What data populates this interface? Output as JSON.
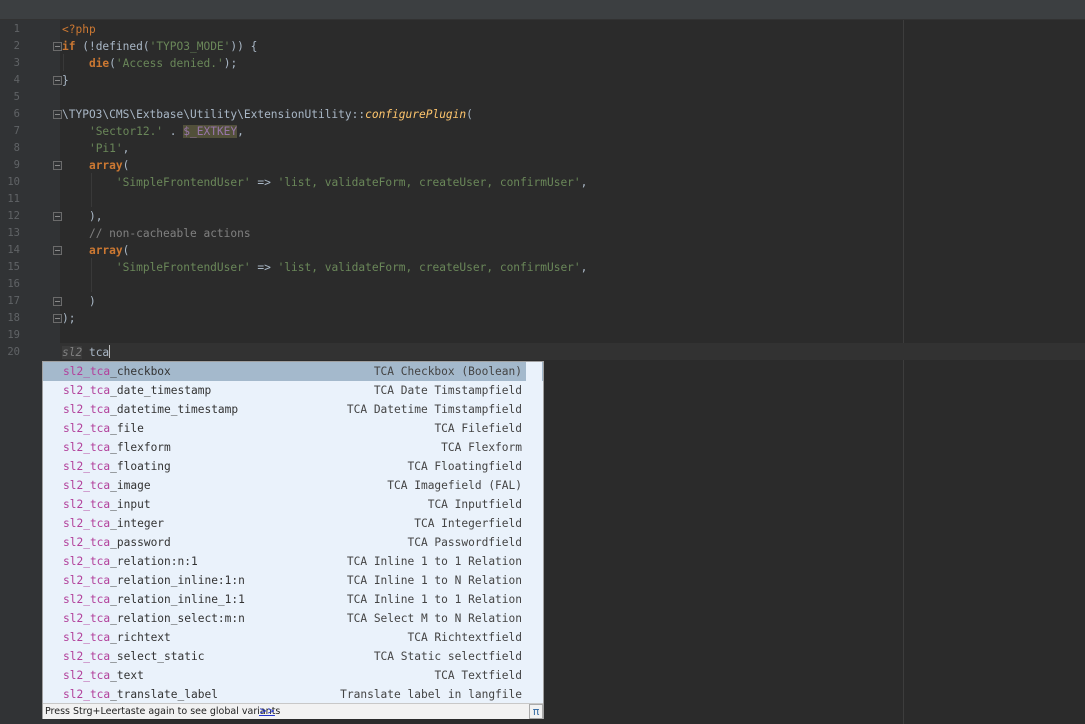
{
  "editor": {
    "lines": [
      {
        "n": "1"
      },
      {
        "n": "2"
      },
      {
        "n": "3"
      },
      {
        "n": "4"
      },
      {
        "n": "5"
      },
      {
        "n": "6"
      },
      {
        "n": "7"
      },
      {
        "n": "8"
      },
      {
        "n": "9"
      },
      {
        "n": "10"
      },
      {
        "n": "11"
      },
      {
        "n": "12"
      },
      {
        "n": "13"
      },
      {
        "n": "14"
      },
      {
        "n": "15"
      },
      {
        "n": "16"
      },
      {
        "n": "17"
      },
      {
        "n": "18"
      },
      {
        "n": "19"
      },
      {
        "n": "20"
      }
    ],
    "code": {
      "l1": "<?php",
      "l2_kw": "if",
      "l2_a": " (!defined(",
      "l2_str": "'TYPO3_MODE'",
      "l2_b": ")) {",
      "l3_kw": "die",
      "l3_a": "(",
      "l3_str": "'Access denied.'",
      "l3_b": ");",
      "l4": "}",
      "l6_a": "\\TYPO3\\CMS\\Extbase\\Utility\\ExtensionUtility::",
      "l6_fn": "configurePlugin",
      "l6_b": "(",
      "l7_str": "'Sector12.'",
      "l7_a": " . ",
      "l7_var": "$_EXTKEY",
      "l7_b": ",",
      "l8_str": "'Pi1'",
      "l8_a": ",",
      "l9_kw": "array",
      "l9_a": "(",
      "l10_str1": "'SimpleFrontendUser'",
      "l10_a": " => ",
      "l10_str2": "'list, validateForm, createUser, confirmUser'",
      "l10_b": ",",
      "l12": "),",
      "l13": "// non-cacheable actions",
      "l14_kw": "array",
      "l14_a": "(",
      "l15_str1": "'SimpleFrontendUser'",
      "l15_a": " => ",
      "l15_str2": "'list, validateForm, createUser, confirmUser'",
      "l15_b": ",",
      "l17": ")",
      "l18": ");",
      "l20_prefix": "sl2",
      "l20_typed": " tca"
    }
  },
  "completion": {
    "match_prefix": "sl2_tca",
    "items": [
      {
        "suffix": "_checkbox",
        "desc": "TCA Checkbox (Boolean)",
        "selected": true
      },
      {
        "suffix": "_date_timestamp",
        "desc": "TCA Date Timstampfield"
      },
      {
        "suffix": "_datetime_timestamp",
        "desc": "TCA Datetime Timstampfield"
      },
      {
        "suffix": "_file",
        "desc": "TCA Filefield"
      },
      {
        "suffix": "_flexform",
        "desc": "TCA Flexform"
      },
      {
        "suffix": "_floating",
        "desc": "TCA Floatingfield"
      },
      {
        "suffix": "_image",
        "desc": "TCA Imagefield (FAL)"
      },
      {
        "suffix": "_input",
        "desc": "TCA Inputfield"
      },
      {
        "suffix": "_integer",
        "desc": "TCA Integerfield"
      },
      {
        "suffix": "_password",
        "desc": "TCA Passwordfield"
      },
      {
        "suffix": "_relation:n:1",
        "desc": "TCA Inline 1 to 1 Relation"
      },
      {
        "suffix": "_relation_inline:1:n",
        "desc": "TCA Inline 1 to N Relation"
      },
      {
        "suffix": "_relation_inline_1:1",
        "desc": "TCA Inline 1 to 1 Relation"
      },
      {
        "suffix": "_relation_select:m:n",
        "desc": "TCA Select M to N Relation"
      },
      {
        "suffix": "_richtext",
        "desc": "TCA Richtextfield"
      },
      {
        "suffix": "_select_static",
        "desc": "TCA Static selectfield"
      },
      {
        "suffix": "_text",
        "desc": "TCA Textfield"
      },
      {
        "suffix": "_translate_label",
        "desc": "Translate label in langfile"
      }
    ],
    "footer_hint": "Press Strg+Leertaste again to see global variants",
    "footer_more": ">>",
    "footer_icon": "π"
  }
}
